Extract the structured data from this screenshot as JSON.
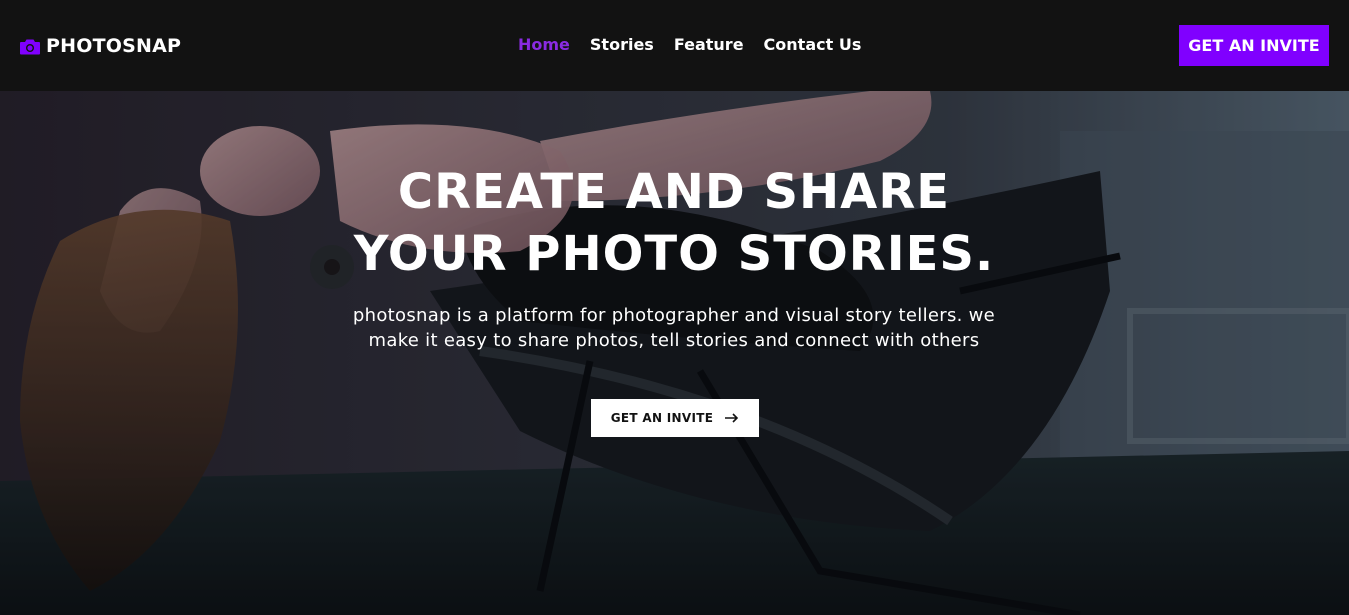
{
  "navbar": {
    "brand": "PHOTOSNAP",
    "brand_icon": "camera-icon",
    "links": [
      {
        "label": "Home",
        "active": true
      },
      {
        "label": "Stories",
        "active": false
      },
      {
        "label": "Feature",
        "active": false
      },
      {
        "label": "Contact Us",
        "active": false
      }
    ],
    "cta_label": "GET AN INVITE"
  },
  "hero": {
    "title_line1": "CREATE AND SHARE",
    "title_line2": "YOUR PHOTO STORIES.",
    "description": "photosnap is a platform for photographer and visual story tellers. we make it easy to share photos, tell stories and connect with others",
    "cta_label": "GET AN INVITE",
    "cta_icon": "arrow-right-icon"
  },
  "colors": {
    "accent": "#8000ff",
    "active_link": "#8a2be2",
    "nav_background": "#121212",
    "text": "#ffffff"
  }
}
